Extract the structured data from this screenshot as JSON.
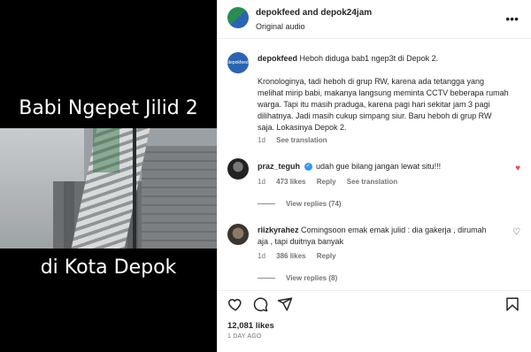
{
  "media": {
    "title_top": "Babi Ngepet Jilid 2",
    "title_bottom": "di Kota Depok"
  },
  "header": {
    "account": "depokfeed and depok24jam",
    "audio": "Original audio",
    "avatar_text": "depokfeed"
  },
  "caption": {
    "username": "depokfeed",
    "line1": "Heboh diduga bab1 ngep3t di Depok 2.",
    "body": "Kronologinya, tadi heboh di grup RW, karena ada tetangga yang melihat mirip babi, makanya langsung meminta CCTV beberapa rumah warga. Tapi itu masih praduga, karena pagi hari sekitar jam 3 pagi dilihatnya. Jadi masih cukup simpang siur. Baru heboh di grup RW saja. Lokasinya Depok 2.",
    "time": "1d",
    "see_translation": "See translation"
  },
  "comments": [
    {
      "username": "praz_teguh",
      "text": "udah gue bilang jangan lewat situ!!!",
      "time": "1d",
      "likes": "473 likes",
      "reply": "Reply",
      "see_translation": "See translation",
      "view_replies": "View replies (74)",
      "liked": true
    },
    {
      "username": "riizkyrahez",
      "text": "Comingsoon emak emak julid : dia gakerja , dirumah aja , tapi duitnya banyak",
      "time": "1d",
      "likes": "386 likes",
      "reply": "Reply",
      "view_replies": "View replies (8)",
      "liked": false
    }
  ],
  "footer": {
    "likes": "12,081 likes",
    "ago": "1 DAY AGO"
  },
  "icons": {
    "like": "heart-outline-icon",
    "comment": "comment-icon",
    "share": "share-icon",
    "save": "bookmark-icon",
    "more": "more-icon"
  },
  "colors": {
    "like_red": "#ed4956",
    "verified_blue": "#3897f0",
    "muted": "#737373"
  }
}
